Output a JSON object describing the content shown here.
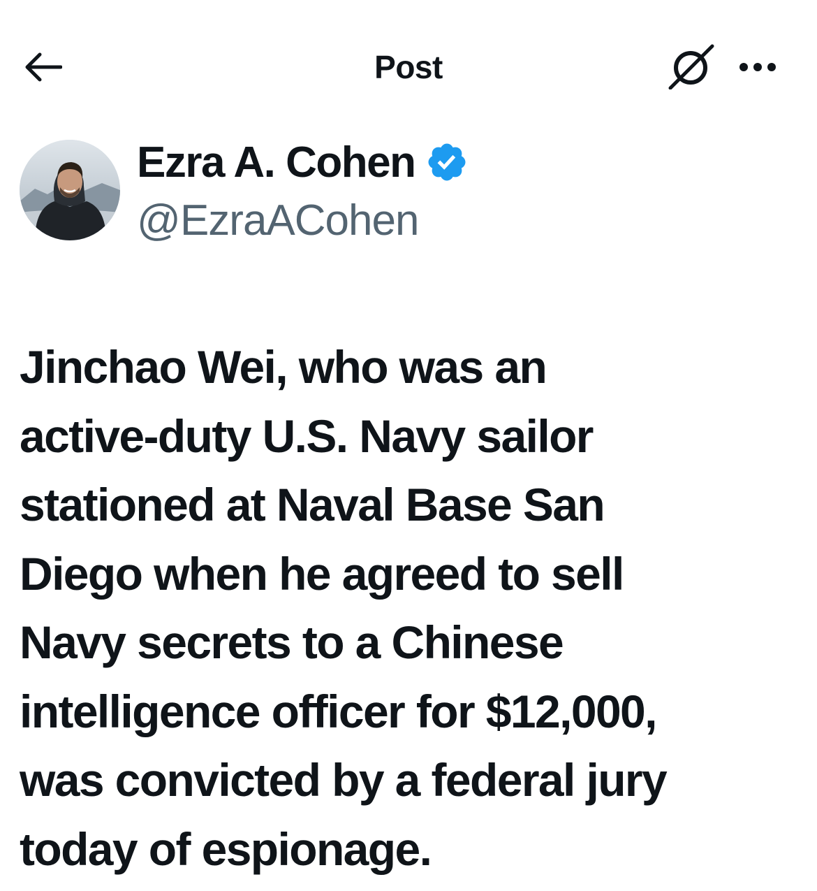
{
  "header": {
    "title": "Post",
    "back_icon": "arrow-left-icon",
    "grok_icon": "grok-icon",
    "more_icon": "more-horizontal-icon"
  },
  "author": {
    "name": "Ezra A. Cohen",
    "handle": "@EzraACohen",
    "verified": true,
    "verified_color": "#1d9bf0"
  },
  "post": {
    "lines": [
      "Jinchao Wei, who was an",
      "active-duty U.S. Navy sailor",
      "stationed at Naval Base San",
      "Diego when he agreed to sell",
      "Navy secrets to a Chinese",
      "intelligence officer for $12,000,",
      "was convicted by a federal jury",
      "today of espionage."
    ]
  },
  "colors": {
    "text_primary": "#0f1419",
    "text_secondary": "#536471",
    "accent": "#1d9bf0",
    "background": "#ffffff"
  }
}
